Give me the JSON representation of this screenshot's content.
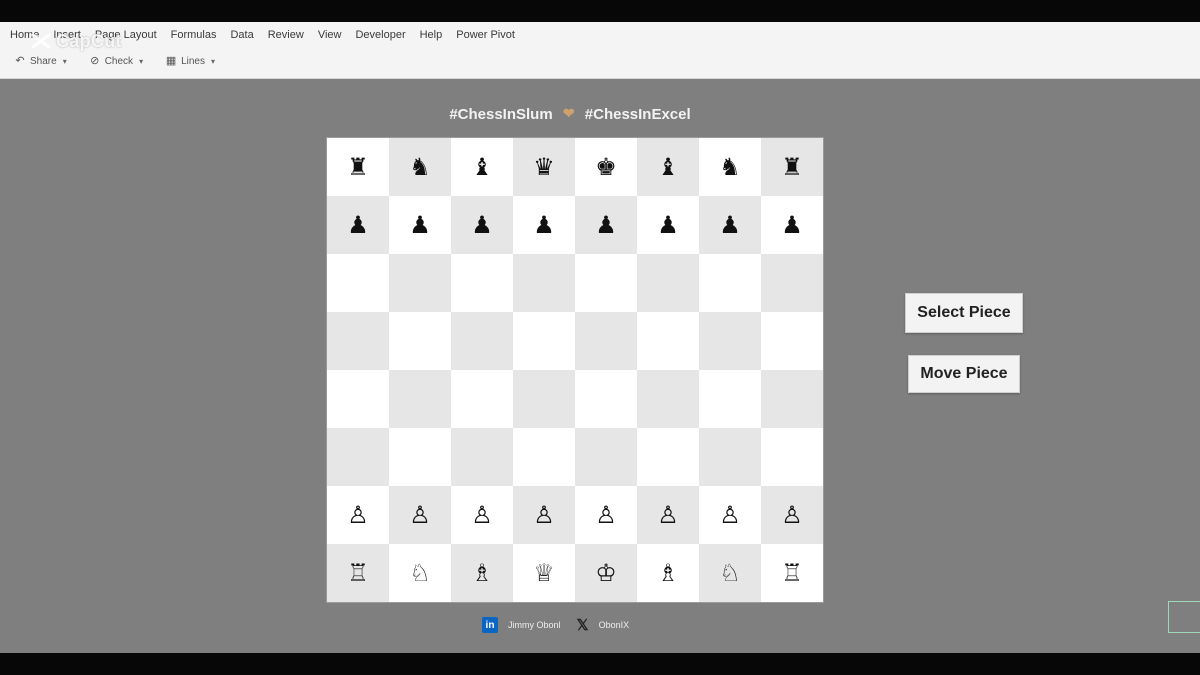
{
  "ribbon": {
    "tabs": [
      "Home",
      "Insert",
      "Page Layout",
      "Formulas",
      "Data",
      "Review",
      "View",
      "Developer",
      "Help",
      "Power Pivot"
    ],
    "tools": [
      {
        "icon": "format-painter-icon",
        "label": "Share",
        "caret": "▾"
      },
      {
        "icon": "link-icon",
        "label": "Check",
        "caret": "▾"
      },
      {
        "icon": "gridlines-icon",
        "label": "Lines",
        "caret": "▾"
      }
    ]
  },
  "watermark": {
    "text": "CapCut",
    "icon": "capcut-icon"
  },
  "page": {
    "title_left": "#ChessInSlum",
    "title_right": "#ChessInExcel",
    "title_emoji": "heart-icon"
  },
  "board": {
    "rows": [
      [
        "♜",
        "♞",
        "♝",
        "♛",
        "♚",
        "♝",
        "♞",
        "♜"
      ],
      [
        "♟",
        "♟",
        "♟",
        "♟",
        "♟",
        "♟",
        "♟",
        "♟"
      ],
      [
        "",
        "",
        "",
        "",
        "",
        "",
        "",
        ""
      ],
      [
        "",
        "",
        "",
        "",
        "",
        "",
        "",
        ""
      ],
      [
        "",
        "",
        "",
        "",
        "",
        "",
        "",
        ""
      ],
      [
        "",
        "",
        "",
        "",
        "",
        "",
        "",
        ""
      ],
      [
        "♙",
        "♙",
        "♙",
        "♙",
        "♙",
        "♙",
        "♙",
        "♙"
      ],
      [
        "♖",
        "♘",
        "♗",
        "♕",
        "♔",
        "♗",
        "♘",
        "♖"
      ]
    ],
    "colors": {
      "light": "#ffffff",
      "dark": "#e6e6e6"
    }
  },
  "buttons": {
    "select": "Select Piece",
    "move": "Move Piece"
  },
  "footer": {
    "linkedin_icon": "in",
    "linkedin_name": "Jimmy Obonl",
    "x_icon": "𝕏",
    "x_handle": "ObonIX"
  },
  "colors": {
    "canvas": "#7f7f7f",
    "ribbon": "#f4f4f4",
    "linkedin": "#0a66c2"
  }
}
